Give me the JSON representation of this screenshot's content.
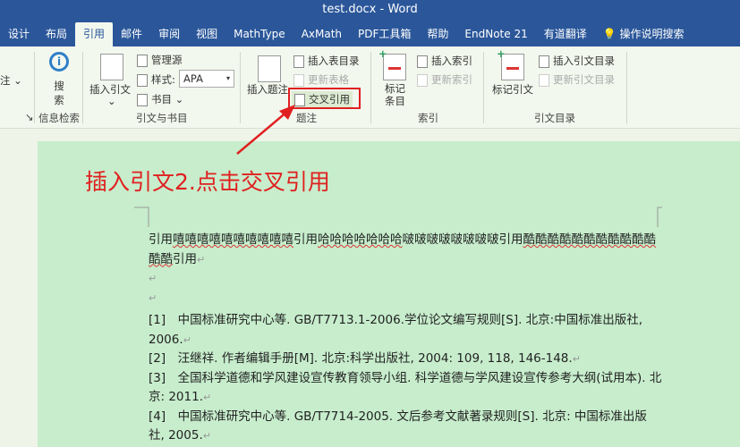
{
  "title": "test.docx  -  Word",
  "tabs": [
    "设计",
    "布局",
    "引用",
    "邮件",
    "审阅",
    "视图",
    "MathType",
    "AxMath",
    "PDF工具箱",
    "帮助",
    "EndNote 21",
    "有道翻译"
  ],
  "tell_me": "操作说明搜索",
  "ribbon": {
    "footnote_partial": "注",
    "search_l1": "搜",
    "search_l2": "索",
    "group_research": "信息检索",
    "insert_citation": "插入引文",
    "manage_sources": "管理源",
    "style_label": "样式:",
    "style_value": "APA",
    "bibliography": "书目",
    "group_citations": "引文与书目",
    "insert_caption": "插入题注",
    "insert_table_of_figures": "插入表目录",
    "update_table": "更新表格",
    "cross_reference": "交叉引用",
    "group_captions": "题注",
    "mark_entry_l1": "标记",
    "mark_entry_l2": "条目",
    "insert_index": "插入索引",
    "update_index": "更新索引",
    "group_index": "索引",
    "mark_citation": "标记引文",
    "insert_table_of_authorities": "插入引文目录",
    "update_table_of_authorities": "更新引文目录",
    "group_authorities": "引文目录"
  },
  "annotation": "插入引文2.点击交叉引用",
  "document": {
    "para1_a": "引用",
    "para1_b": "嘻嘻嘻嘻嘻嘻嘻嘻嘻嘻",
    "para1_c": "引用",
    "para1_d": "哈哈哈哈哈哈哈",
    "para1_e": "啵啵啵啵啵啵啵啵",
    "para1_f": "引用",
    "para1_g": "酷酷酷酷酷酷酷酷酷酷酷酷酷",
    "para1_h": "引用",
    "refs": [
      "[1]　中国标准研究中心等. GB/T7713.1-2006.学位论文编写规则[S]. 北京:中国标准出版社, 2006.",
      "[2]　汪继祥. 作者编辑手册[M]. 北京:科学出版社, 2004: 109, 118, 146-148.",
      "[3]　全国科学道德和学风建设宣传教育领导小组. 科学道德与学风建设宣传参考大纲(试用本). 北京: 2011.",
      "[4]　中国标准研究中心等. GB/T7714-2005. 文后参考文献著录规则[S]. 北京: 中国标准出版社, 2005."
    ],
    "para_mark": "↵"
  }
}
